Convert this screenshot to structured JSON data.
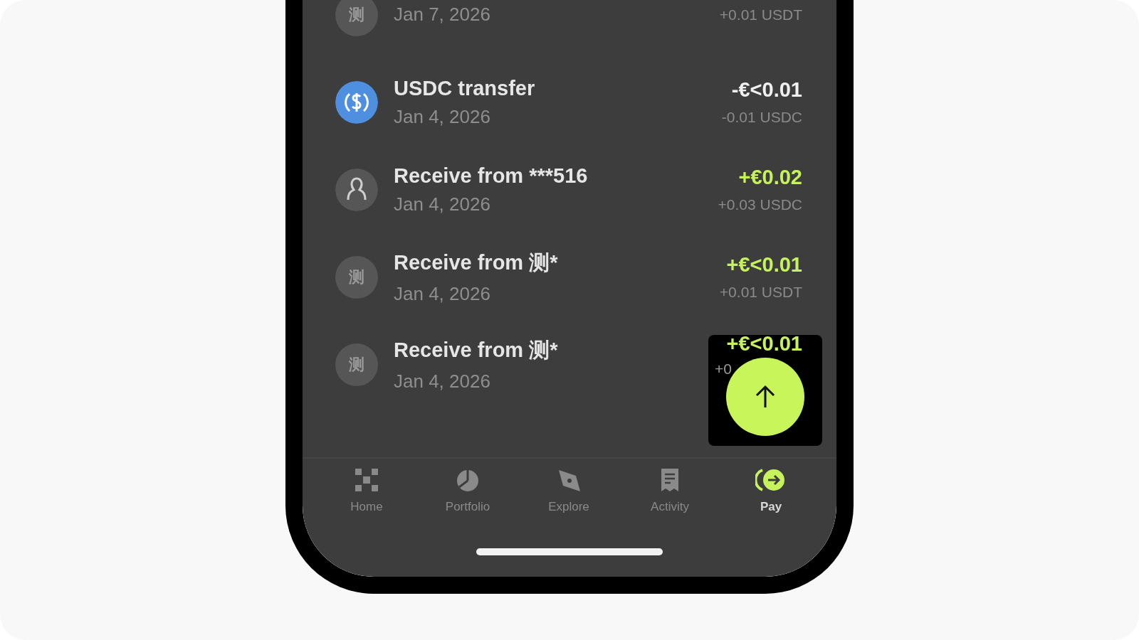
{
  "transactions": [
    {
      "avatar": {
        "kind": "glyph",
        "text": "测"
      },
      "date": "Jan 7, 2026",
      "sub_amount": "+0.01 USDT"
    },
    {
      "avatar": {
        "kind": "coin"
      },
      "title": "USDC transfer",
      "date": "Jan 4, 2026",
      "amount": "-€<0.01",
      "color": "#f0f0f0",
      "sub_amount": "-0.01 USDC"
    },
    {
      "avatar": {
        "kind": "person"
      },
      "title": "Receive from ***516",
      "date": "Jan 4, 2026",
      "amount": "+€0.02",
      "color": "#c6f35b",
      "sub_amount": "+0.03 USDC"
    },
    {
      "avatar": {
        "kind": "glyph",
        "text": "测"
      },
      "title": "Receive from 测*",
      "date": "Jan 4, 2026",
      "amount": "+€<0.01",
      "color": "#c6f35b",
      "sub_amount": "+0.01 USDT"
    },
    {
      "avatar": {
        "kind": "glyph",
        "text": "测"
      },
      "title": "Receive from 测*",
      "date": "Jan 4, 2026",
      "amount": "+€<0.01",
      "color": "#c6f35b",
      "sub_amount": "+0",
      "overlaid": true
    }
  ],
  "nav": [
    {
      "kind": "home",
      "label": "Home",
      "selected": false
    },
    {
      "kind": "portfolio",
      "label": "Portfolio",
      "selected": false
    },
    {
      "kind": "explore",
      "label": "Explore",
      "selected": false
    },
    {
      "kind": "activity",
      "label": "Activity",
      "selected": false
    },
    {
      "kind": "pay",
      "label": "Pay",
      "selected": true
    }
  ]
}
